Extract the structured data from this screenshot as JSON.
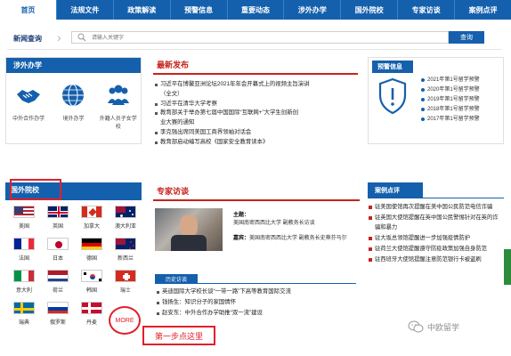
{
  "nav": {
    "items": [
      "首页",
      "法规文件",
      "政策解读",
      "预警信息",
      "重要动态",
      "涉外办学",
      "国外院校",
      "专家访谈",
      "案例点评"
    ],
    "active_index": 0
  },
  "search": {
    "title": "新闻查询",
    "placeholder": "请输入关键字",
    "button_label": "查询"
  },
  "foreign_education": {
    "title": "涉外办学",
    "items": [
      {
        "label": "中外合作办学",
        "icon": "handshake-icon"
      },
      {
        "label": "境外办学",
        "icon": "globe-icon"
      },
      {
        "label": "外籍人员子女学校",
        "icon": "people-icon"
      }
    ]
  },
  "latest": {
    "title": "最新发布",
    "items": [
      {
        "text": "习近平在博鳌亚洲论坛2021年年会开幕式上的视频主旨演讲",
        "cont": false
      },
      {
        "text": "（全文）",
        "cont": true
      },
      {
        "text": "习近平在清华大学考察",
        "cont": false
      },
      {
        "text": "教育部关于举办第七届中国国际“互联网+”大学生创新创",
        "cont": false
      },
      {
        "text": "业大赛的通知",
        "cont": true
      },
      {
        "text": "李克强出席同美国工商界领袖对话会",
        "cont": false
      },
      {
        "text": "教育部启动编写高校《国家安全教育读本》",
        "cont": false
      }
    ]
  },
  "warning": {
    "title": "预警信息",
    "items": [
      "2021年第1号留学预警",
      "2020年第1号留学预警",
      "2019年第1号留学预警",
      "2018年第1号留学预警",
      "2017年第1号留学预警"
    ]
  },
  "foreign_schools": {
    "title": "国外院校",
    "countries": [
      {
        "label": "美国",
        "flag": "us"
      },
      {
        "label": "英国",
        "flag": "uk"
      },
      {
        "label": "加拿大",
        "flag": "ca"
      },
      {
        "label": "澳大利亚",
        "flag": "au"
      },
      {
        "label": "法国",
        "flag": "fr"
      },
      {
        "label": "日本",
        "flag": "jp"
      },
      {
        "label": "德国",
        "flag": "de"
      },
      {
        "label": "新西兰",
        "flag": "nz"
      },
      {
        "label": "意大利",
        "flag": "it"
      },
      {
        "label": "荷兰",
        "flag": "nl"
      },
      {
        "label": "韩国",
        "flag": "kr"
      },
      {
        "label": "瑞士",
        "flag": "ch"
      },
      {
        "label": "瑞典",
        "flag": "se"
      },
      {
        "label": "俄罗斯",
        "flag": "ru"
      },
      {
        "label": "丹麦",
        "flag": "dk"
      }
    ],
    "more_label": "MORE"
  },
  "expert": {
    "title": "专家访谈",
    "topic_label": "主题：",
    "topic_value": "美国南密西西比大学 副教务长访谈",
    "guest_label": "嘉宾：",
    "guest_value": "美国南密西西比大学 副教务长史蒂芬马尔",
    "history_tag": "历史访谈",
    "history": [
      "英迪国际大学校长谈“一带一路”下高等教育国际交流",
      "钱扬生：知识分子的家国情怀",
      "赵安东：中外合作办学助推“双一流”建设"
    ]
  },
  "cases": {
    "title": "案例点评",
    "items": [
      "驻美国使馆再次提醒在美中国公民防范电信诈骗",
      "驻英国大使馆提醒在英中国公民警惕针对在英的诈骗和暴力",
      "驻大坂总领馆提醒进一步加强疫情防护",
      "驻荷兰大使馆提醒遵守防疫政策加强自身防范",
      "驻西班牙大使馆提醒注意防范银行卡被盗刷"
    ]
  },
  "annotation": {
    "text": "第一步点这里"
  },
  "watermark": {
    "text": "中欧留学"
  },
  "colors": {
    "primary": "#1560ad",
    "accent_red": "#c6231b",
    "annotation_red": "#e0202c"
  }
}
